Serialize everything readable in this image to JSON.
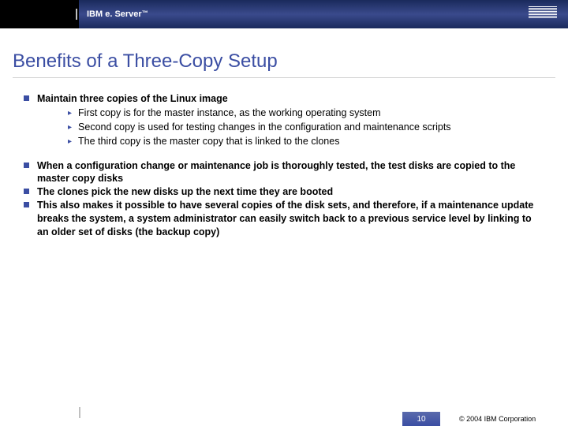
{
  "header": {
    "brand_prefix": "IBM e. Server",
    "brand_tm": "™"
  },
  "title": "Benefits of a Three-Copy Setup",
  "main_bullet": "Maintain three copies of the Linux image",
  "sub_bullets": [
    "First copy is for the master instance, as the working operating system",
    "Second copy is used for testing changes in the configuration and maintenance scripts",
    "The third copy is the master copy that is linked to the clones"
  ],
  "secondary_bullets": [
    "When a configuration change or maintenance job is thoroughly tested, the test disks are copied to the master copy disks",
    "The clones pick the new disks up the next time they are booted",
    "This also makes it possible to have several copies of the disk sets, and therefore, if a maintenance update breaks the system, a system administrator can easily switch back to a previous service level by linking to an older set of disks (the backup copy)"
  ],
  "footer": {
    "page": "10",
    "copyright": "© 2004 IBM Corporation"
  }
}
